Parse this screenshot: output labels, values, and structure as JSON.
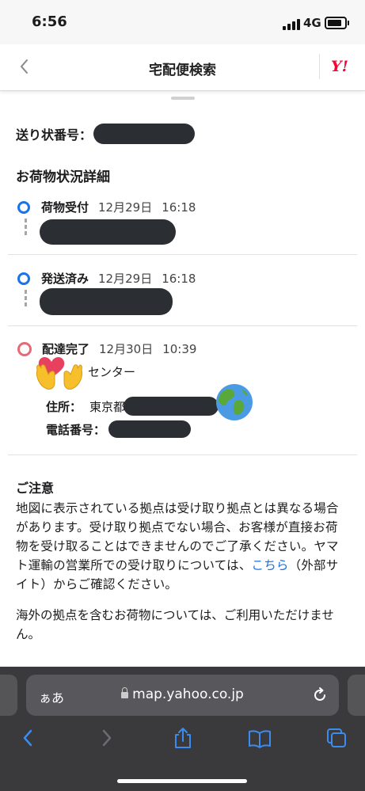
{
  "status_bar": {
    "time": "6:56",
    "network": "4G"
  },
  "nav": {
    "title": "宅配便検索",
    "logo": "Y!"
  },
  "invoice": {
    "label": "送り状番号："
  },
  "section_title": "お荷物状況詳細",
  "statuses": [
    {
      "label": "荷物受付",
      "date": "12月29日",
      "time": "16:18",
      "color": "#1a73e8"
    },
    {
      "label": "発送済み",
      "date": "12月29日",
      "time": "16:18",
      "color": "#1a73e8"
    },
    {
      "label": "配達完了",
      "date": "12月30日",
      "time": "10:39",
      "color": "#e46a78"
    }
  ],
  "delivery": {
    "center_suffix": "センター",
    "address_label": "住所：",
    "address_prefix": "東京都",
    "phone_label": "電話番号："
  },
  "notice": {
    "title": "ご注意",
    "body_main": "地図に表示されている拠点は受け取り拠点とは異なる場合があります。受け取り拠点でない場合、お客様が直接お荷物を受け取ることはできませんのでご了承ください。ヤマト運輸の営業所での受け取りについては、",
    "link": "こちら",
    "body_tail": "（外部サイト）からご確認ください。",
    "body_second": "海外の拠点を含むお荷物については、ご利用いただけません。"
  },
  "browser": {
    "aa": "ぁあ",
    "url": "map.yahoo.co.jp"
  },
  "icons": [
    "back-chevron-icon",
    "yahoo-logo",
    "lock-icon",
    "reload-icon",
    "back-arrow-icon",
    "forward-arrow-icon",
    "share-icon",
    "bookmarks-icon",
    "tabs-icon",
    "hands-emoji",
    "globe-emoji"
  ]
}
